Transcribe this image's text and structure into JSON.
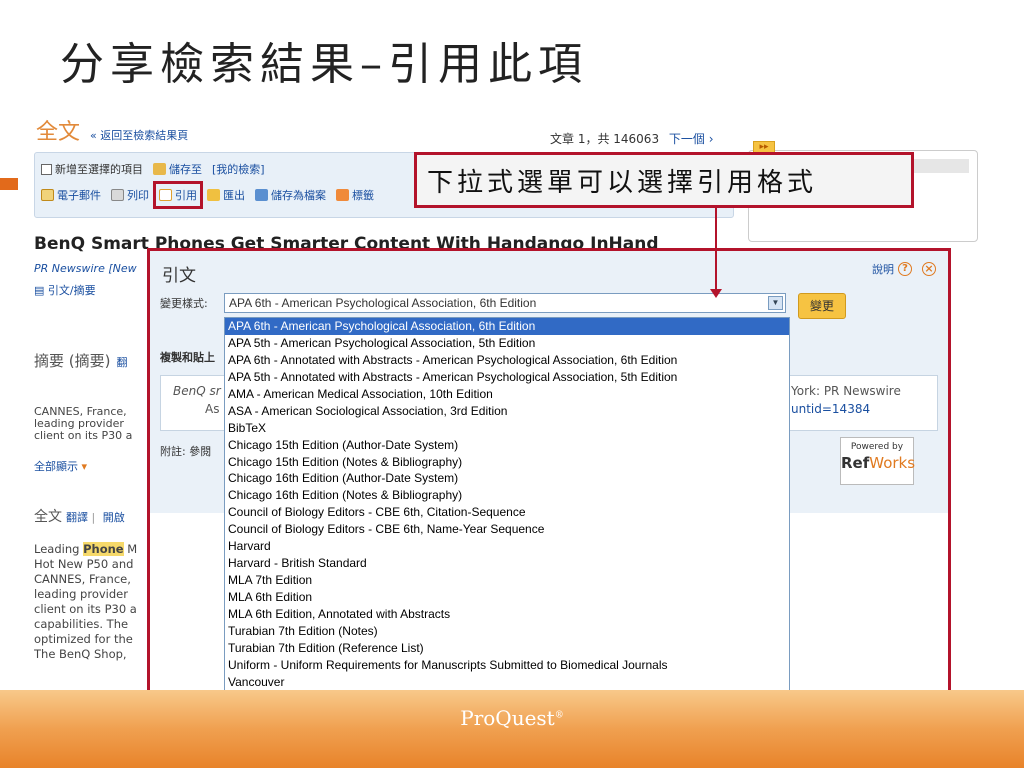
{
  "slide_title": "分享檢索結果–引用此項",
  "page": {
    "fulltext_heading": "全文",
    "back_link": "« 返回至檢索結果頁",
    "doc_position": "文章 1，共 146063",
    "next_link": "下一個 ›",
    "toolbar": {
      "add_to_selected": "新增至選擇的項目",
      "save_to": "儲存至",
      "my_searches": "[我的檢索]",
      "email": "電子郵件",
      "print": "列印",
      "cite": "引用",
      "export": "匯出",
      "save_as_file": "儲存為檔案",
      "tags": "標籤"
    },
    "article_title": "BenQ Smart Phones Get Smarter Content With Handango InHand",
    "article_source": "PR Newswire [New",
    "citation_abstract_link": "引文/摘要",
    "abstract_heading": "摘要 (摘要)",
    "translate_short": "翻",
    "abstract_lines": [
      "CANNES, France,",
      "leading provider",
      "client on its P30 a"
    ],
    "show_all": "全部顯示",
    "fulltext_heading2": "全文",
    "translate": "翻譯",
    "open": "開啟",
    "fulltext_lines": {
      "l1_pre": "Leading ",
      "l1_hl": "Phone",
      "l1_post": " M",
      "rest": [
        "Hot New P50 and",
        "CANNES, France,",
        "leading provider",
        "client on its P30 a",
        "capabilities. The",
        "optimized for the",
        "The BenQ Shop,"
      ]
    }
  },
  "callout": "下拉式選單可以選擇引用格式",
  "dialog": {
    "title": "引文",
    "help": "說明",
    "help_icon": "?",
    "close_icon": "×",
    "style_label": "變更樣式:",
    "selected_style": "APA 6th - American Psychological Association, 6th Edition",
    "change_button": "變更",
    "copy_paste_label": "複製和貼上",
    "citation_left_1": "BenQ sr",
    "citation_left_2": "As",
    "citation_right_1": "York: PR Newswire",
    "citation_right_2": "untid=14384",
    "note": "附註: 參閱",
    "powered_by": "Powered by",
    "refworks_a": "Ref",
    "refworks_b": "Works",
    "options": [
      "APA 6th - American Psychological Association, 6th Edition",
      "APA 5th - American Psychological Association, 5th Edition",
      "APA 6th - Annotated with Abstracts - American Psychological Association, 6th Edition",
      "APA 5th - Annotated with Abstracts - American Psychological Association, 5th Edition",
      "AMA - American Medical Association, 10th Edition",
      "ASA - American Sociological Association, 3rd Edition",
      "BibTeX",
      "Chicago 15th Edition (Author-Date System)",
      "Chicago 15th Edition (Notes & Bibliography)",
      "Chicago 16th Edition (Author-Date System)",
      "Chicago 16th Edition (Notes & Bibliography)",
      "Council of Biology Editors - CBE 6th, Citation-Sequence",
      "Council of Biology Editors - CBE 6th, Name-Year Sequence",
      "Harvard",
      "Harvard - British Standard",
      "MLA 7th Edition",
      "MLA 6th Edition",
      "MLA 6th Edition, Annotated with Abstracts",
      "Turabian 7th Edition (Notes)",
      "Turabian 7th Edition (Reference List)",
      "Uniform - Uniform Requirements for Manuscripts Submitted to Biomedical Journals",
      "Vancouver"
    ],
    "selected_index": 0
  },
  "footer_logo": "ProQuest",
  "footer_logo_reg": "®",
  "colors": {
    "accent_red": "#b3132b",
    "orange": "#e8832a",
    "select_highlight": "#316ac5"
  }
}
